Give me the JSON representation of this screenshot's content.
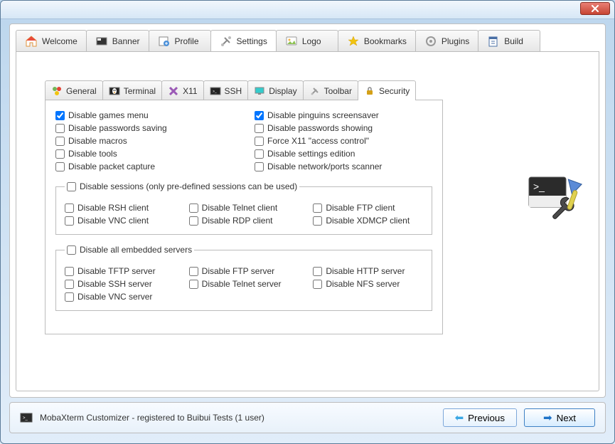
{
  "main_tabs": [
    {
      "label": "Welcome"
    },
    {
      "label": "Banner"
    },
    {
      "label": "Profile"
    },
    {
      "label": "Settings"
    },
    {
      "label": "Logo"
    },
    {
      "label": "Bookmarks"
    },
    {
      "label": "Plugins"
    },
    {
      "label": "Build"
    }
  ],
  "sub_tabs": [
    {
      "label": "General"
    },
    {
      "label": "Terminal"
    },
    {
      "label": "X11"
    },
    {
      "label": "SSH"
    },
    {
      "label": "Display"
    },
    {
      "label": "Toolbar"
    },
    {
      "label": "Security"
    }
  ],
  "top_options": {
    "left": [
      {
        "label": "Disable games menu",
        "checked": true
      },
      {
        "label": "Disable passwords saving",
        "checked": false
      },
      {
        "label": "Disable macros",
        "checked": false
      },
      {
        "label": "Disable tools",
        "checked": false
      },
      {
        "label": "Disable packet capture",
        "checked": false
      }
    ],
    "right": [
      {
        "label": "Disable pinguins screensaver",
        "checked": true
      },
      {
        "label": "Disable passwords showing",
        "checked": false
      },
      {
        "label": "Force X11 \"access control\"",
        "checked": false
      },
      {
        "label": "Disable settings edition",
        "checked": false
      },
      {
        "label": "Disable network/ports scanner",
        "checked": false
      }
    ]
  },
  "sessions_group": {
    "legend": "Disable sessions (only pre-defined sessions can be used)",
    "legend_checked": false,
    "items": [
      {
        "label": "Disable RSH client"
      },
      {
        "label": "Disable Telnet client"
      },
      {
        "label": "Disable FTP client"
      },
      {
        "label": "Disable VNC client"
      },
      {
        "label": "Disable RDP client"
      },
      {
        "label": "Disable XDMCP client"
      }
    ]
  },
  "servers_group": {
    "legend": "Disable all embedded servers",
    "legend_checked": false,
    "items": [
      {
        "label": "Disable TFTP server"
      },
      {
        "label": "Disable FTP server"
      },
      {
        "label": "Disable HTTP server"
      },
      {
        "label": "Disable SSH server"
      },
      {
        "label": "Disable Telnet server"
      },
      {
        "label": "Disable NFS server"
      },
      {
        "label": "Disable VNC server"
      }
    ]
  },
  "footer": {
    "status": "MobaXterm Customizer - registered to Buibui Tests (1 user)",
    "previous": "Previous",
    "next": "Next"
  }
}
